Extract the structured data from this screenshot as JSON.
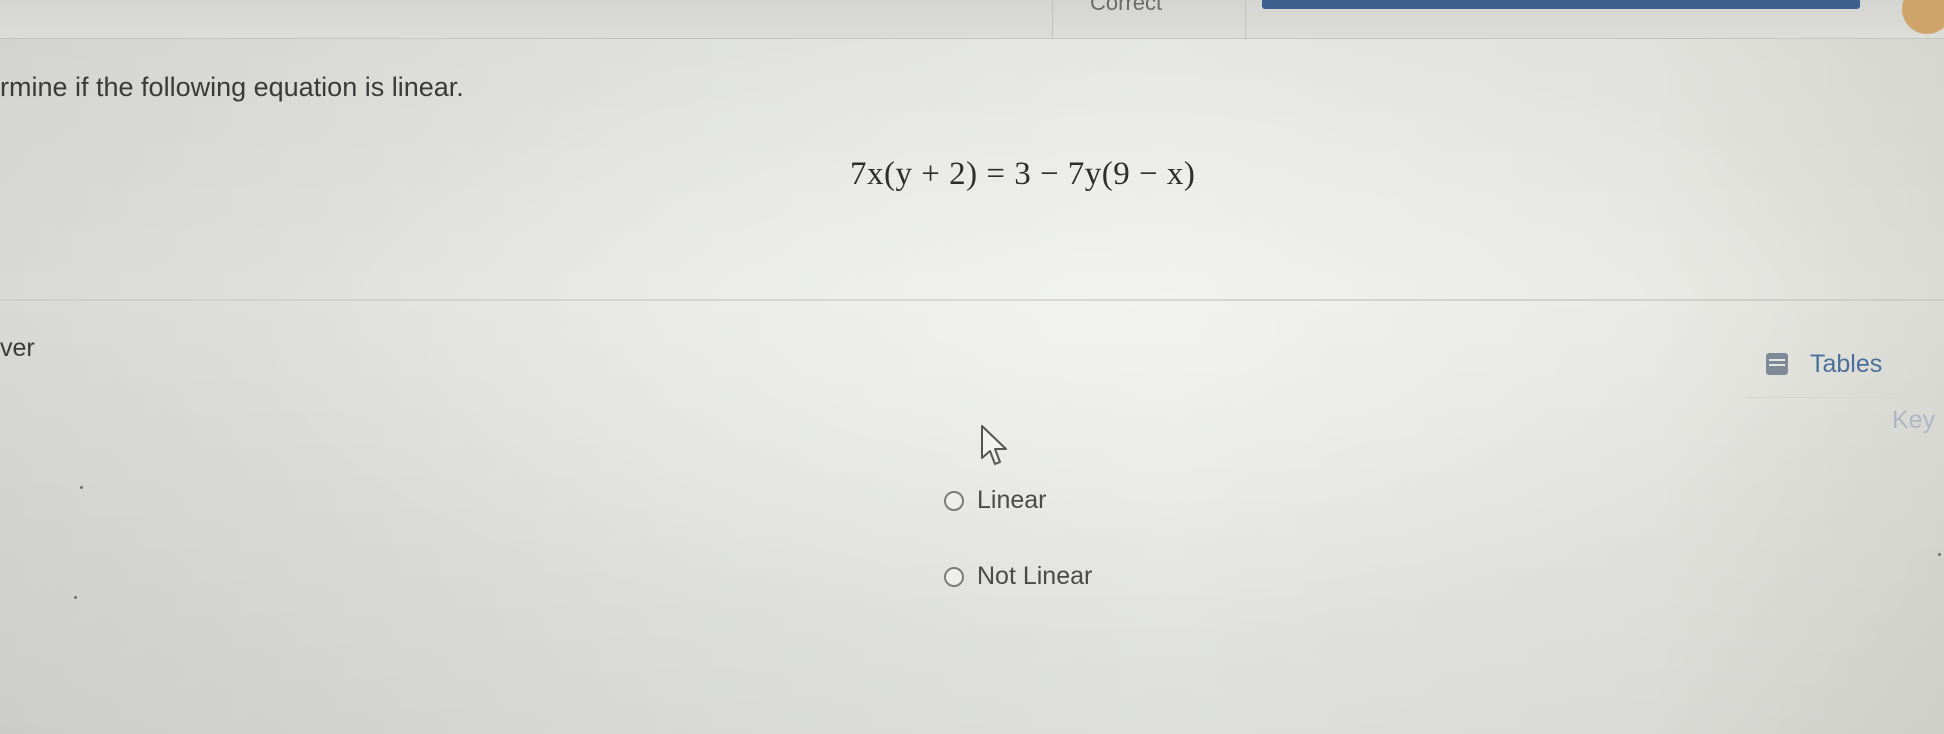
{
  "header": {
    "status_text": "Correct",
    "progress_fraction": 1.0,
    "colors": {
      "progress": "#3d5f8e",
      "avatar": "#cfa46b"
    }
  },
  "question": {
    "prompt": "rmine if the following equation is linear.",
    "equation": "7x(y + 2) = 3 − 7y(9 − x)"
  },
  "answer": {
    "label": "ver",
    "tools": {
      "tables_label": "Tables",
      "tables_icon": "table-icon",
      "key_label": "Key"
    },
    "options": [
      {
        "label": "Linear",
        "selected": false
      },
      {
        "label": "Not Linear",
        "selected": false
      }
    ]
  }
}
